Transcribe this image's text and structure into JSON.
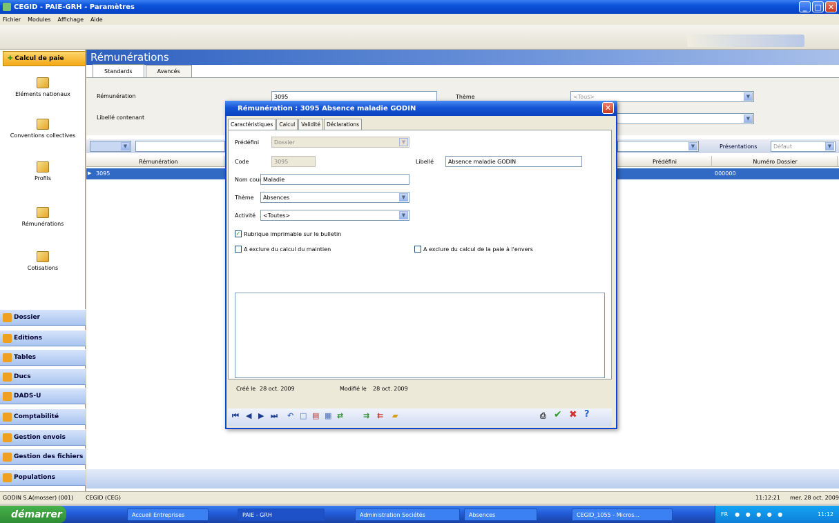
{
  "window": {
    "title": "CEGID - PAIE-GRH - Paramètres"
  },
  "menu": [
    "Fichier",
    "Modules",
    "Affichage",
    "Aide"
  ],
  "nav": {
    "header": "Calcul de paie",
    "items": [
      "Eléments nationaux",
      "Conventions collectives",
      "Profils",
      "Rémunérations",
      "Cotisations"
    ],
    "groups": [
      "Dossier",
      "Editions",
      "Tables",
      "Ducs",
      "DADS-U",
      "Comptabilité",
      "Gestion envois",
      "Gestion des fichiers",
      "Populations"
    ]
  },
  "main": {
    "title": "Rémunérations",
    "tabs": [
      "Standards",
      "Avancés"
    ],
    "filters": {
      "remuneration_label": "Rémunération",
      "remuneration_value": "3095",
      "libelle_label": "Libellé contenant",
      "theme_label": "Thème",
      "theme_value": "<Tous>"
    },
    "presentations_label": "Présentations",
    "presentations_value": "Défaut",
    "columns": [
      "Rémunération",
      "Prédéfini",
      "Numéro Dossier"
    ],
    "row": {
      "remuneration": "3095",
      "numero_dossier": "000000"
    }
  },
  "dialog": {
    "title": "Rémunération : 3095 Absence maladie GODIN",
    "tabs": [
      "Caractéristiques",
      "Calcul",
      "Validité",
      "Déclarations"
    ],
    "fields": {
      "predefini_label": "Prédéfini",
      "predefini_value": "Dossier",
      "code_label": "Code",
      "code_value": "3095",
      "libelle_label": "Libellé",
      "libelle_value": "Absence maladie GODIN",
      "nomcourt_label": "Nom court",
      "nomcourt_value": "Maladie",
      "theme_label": "Thème",
      "theme_value": "Absences",
      "activite_label": "Activité",
      "activite_value": "<Toutes>"
    },
    "checkboxes": {
      "imprimable": {
        "label": "Rubrique imprimable sur le bulletin",
        "checked": true
      },
      "maintien": {
        "label": "A exclure du calcul du maintien",
        "checked": false
      },
      "envers": {
        "label": "A exclure du calcul de la paie à l'envers",
        "checked": false
      }
    },
    "footer": {
      "cree_label": "Créé le",
      "cree_value": "28 oct. 2009",
      "modifie_label": "Modifié le",
      "modifie_value": "28 oct. 2009"
    }
  },
  "status": {
    "user": "GODIN S.A(mosser) (001)",
    "company": "CEGID (CEG)",
    "time": "11:12:21",
    "date": "mer. 28 oct. 2009"
  },
  "taskbar": {
    "start": "démarrer",
    "items": [
      "Accueil Entreprises",
      "PAIE - GRH",
      "Administration Sociétés",
      "Absences",
      "CEGID_1055 - Micros..."
    ],
    "clock": "11:12",
    "lang": "FR"
  }
}
